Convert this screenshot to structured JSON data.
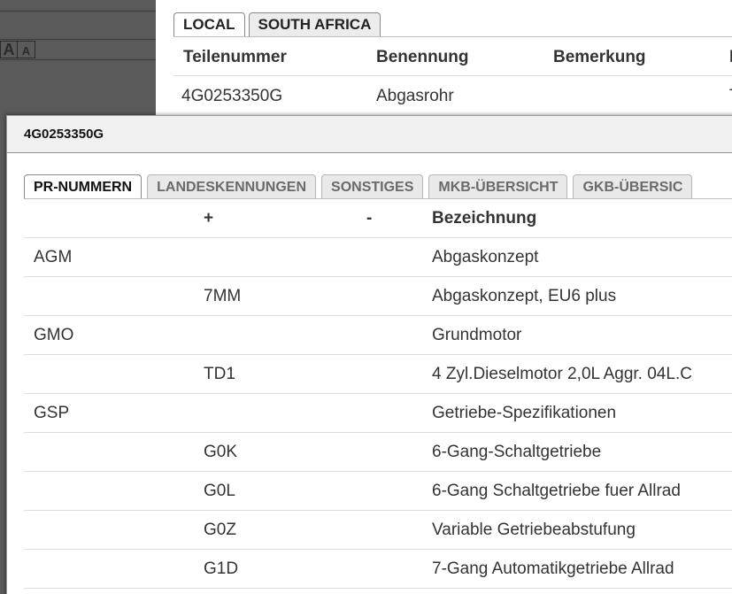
{
  "font_size": {
    "large_label": "A",
    "small_label": "A"
  },
  "background": {
    "tabs": [
      {
        "label": "LOCAL",
        "active": true
      },
      {
        "label": "SOUTH AFRICA",
        "active": false
      }
    ],
    "table": {
      "columns": [
        "Teilenummer",
        "Benennung",
        "Bemerkung",
        "L"
      ],
      "rows": [
        {
          "teilenummer": "4G0253350G",
          "benennung": "Abgasrohr",
          "bemerkung": "",
          "extra": "T"
        }
      ]
    }
  },
  "dialog": {
    "title": "4G0253350G",
    "tabs": [
      {
        "label": "PR-NUMMERN",
        "active": true
      },
      {
        "label": "LANDESKENNUNGEN",
        "active": false
      },
      {
        "label": "SONSTIGES",
        "active": false
      },
      {
        "label": "MKB-ÜBERSICHT",
        "active": false
      },
      {
        "label": "GKB-ÜBERSIC",
        "active": false
      }
    ],
    "columns": [
      "",
      "+",
      "-",
      "Bezeichnung"
    ],
    "rows": [
      {
        "family": "AGM",
        "plus": "",
        "minus": "",
        "desc": "Abgaskonzept"
      },
      {
        "family": "",
        "plus": "7MM",
        "minus": "",
        "desc": "Abgaskonzept, EU6 plus"
      },
      {
        "family": "GMO",
        "plus": "",
        "minus": "",
        "desc": "Grundmotor"
      },
      {
        "family": "",
        "plus": "TD1",
        "minus": "",
        "desc": "4 Zyl.Dieselmotor 2,0L Aggr. 04L.C"
      },
      {
        "family": "GSP",
        "plus": "",
        "minus": "",
        "desc": "Getriebe-Spezifikationen"
      },
      {
        "family": "",
        "plus": "G0K",
        "minus": "",
        "desc": "6-Gang-Schaltgetriebe"
      },
      {
        "family": "",
        "plus": "G0L",
        "minus": "",
        "desc": "6-Gang Schaltgetriebe fuer Allrad"
      },
      {
        "family": "",
        "plus": "G0Z",
        "minus": "",
        "desc": "Variable Getriebeabstufung"
      },
      {
        "family": "",
        "plus": "G1D",
        "minus": "",
        "desc": "7-Gang Automatikgetriebe Allrad"
      }
    ]
  }
}
